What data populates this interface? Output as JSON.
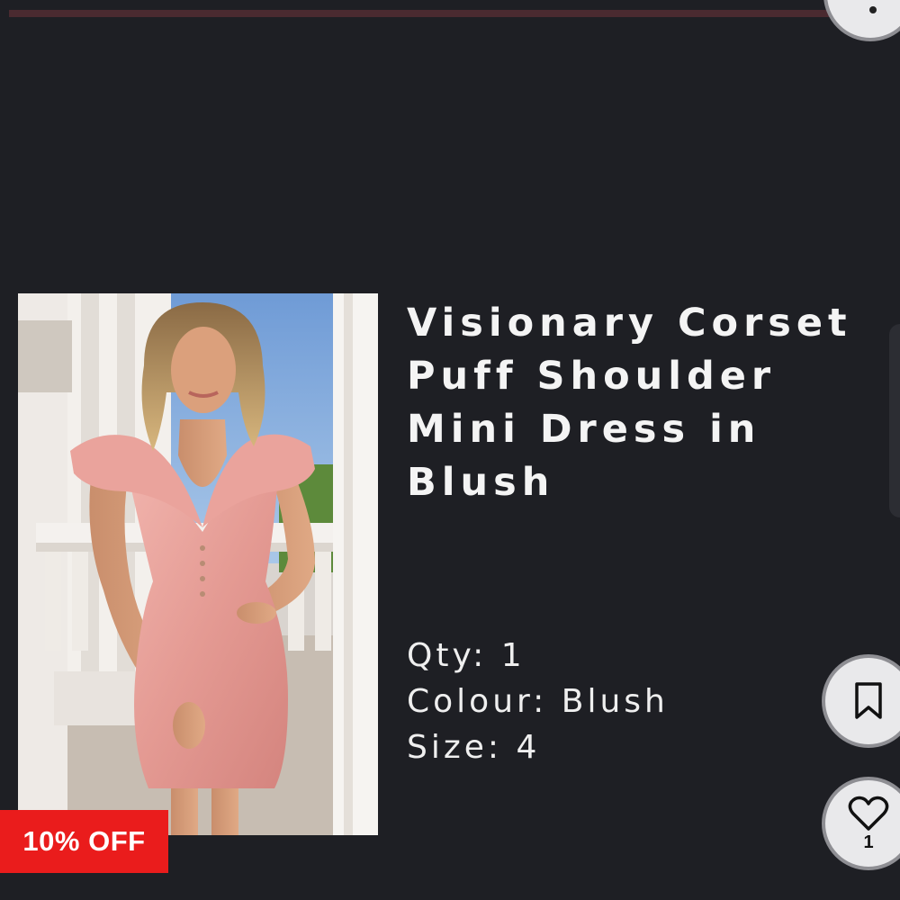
{
  "colors": {
    "background": "#1e1f24",
    "discount_badge": "#ea1c1c",
    "title_text": "#f4f4f4",
    "fab_background": "#e9e9eb"
  },
  "product": {
    "title": "Visionary Corset Puff Shoulder Mini Dress in Blush",
    "discount_label": "10% OFF",
    "qty_label": "Qty:",
    "qty_value": "1",
    "colour_label": "Colour:",
    "colour_value": "Blush",
    "size_label": "Size:",
    "size_value": "4",
    "image_icon": "product-photo"
  },
  "actions": {
    "bookmark_icon": "bookmark-icon",
    "like_icon": "heart-icon",
    "like_count": "1",
    "top_icon": "more-icon"
  }
}
